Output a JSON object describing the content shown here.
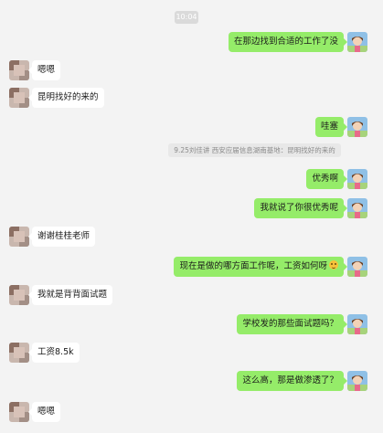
{
  "chat": {
    "timestamp": "10:04",
    "quote_text": "9.25刘佳讲 西安应届信息湖南基地：昆明找好的来的",
    "messages": [
      {
        "from": "me",
        "text": "在那边找到合适的工作了没"
      },
      {
        "from": "other",
        "text": "嗯嗯"
      },
      {
        "from": "other",
        "text": "昆明找好的来的"
      },
      {
        "from": "me",
        "text": "哇塞"
      },
      {
        "from": "me",
        "text": "优秀啊"
      },
      {
        "from": "me",
        "text": "我就说了你很优秀呢"
      },
      {
        "from": "other",
        "text": "谢谢桂桂老师"
      },
      {
        "from": "me",
        "text": "现在是做的哪方面工作呢，工资如何呀",
        "emoji": "smile-emoji"
      },
      {
        "from": "other",
        "text": "我就是背背面试题"
      },
      {
        "from": "me",
        "text": "学校发的那些面试题吗？"
      },
      {
        "from": "other",
        "text": "工资8.5k"
      },
      {
        "from": "me",
        "text": "这么高，那是做渗透了？"
      },
      {
        "from": "other",
        "text": "嗯嗯"
      }
    ]
  },
  "colors": {
    "background": "#f3f3f3",
    "my_bubble": "#95ec69",
    "other_bubble": "#ffffff",
    "time_pill": "#dadada",
    "quote_bg": "#e8e8e8"
  }
}
